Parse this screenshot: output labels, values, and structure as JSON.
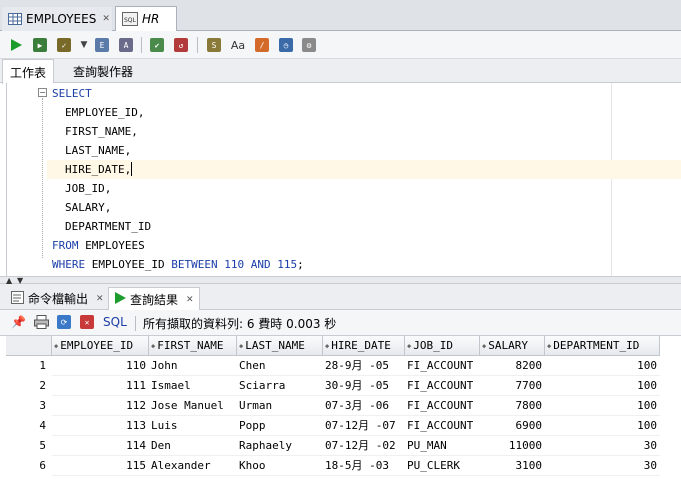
{
  "doc_tabs": [
    {
      "label": "EMPLOYEES",
      "icon": "table-icon"
    },
    {
      "label": "HR",
      "icon": "sql-worksheet-icon"
    }
  ],
  "sub_tabs": {
    "worksheet": "工作表",
    "query_builder": "查詢製作器"
  },
  "editor": {
    "lines": [
      {
        "kw": "SELECT",
        "text": ""
      },
      {
        "kw": "",
        "text": "EMPLOYEE_ID,"
      },
      {
        "kw": "",
        "text": "FIRST_NAME,"
      },
      {
        "kw": "",
        "text": "LAST_NAME,"
      },
      {
        "kw": "",
        "text": "HIRE_DATE,"
      },
      {
        "kw": "",
        "text": "JOB_ID,"
      },
      {
        "kw": "",
        "text": "SALARY,"
      },
      {
        "kw": "",
        "text": "DEPARTMENT_ID"
      },
      {
        "kw": "FROM",
        "text": " EMPLOYEES"
      }
    ],
    "where": {
      "kw1": "WHERE",
      "col": " EMPLOYEE_ID ",
      "kw2": "BETWEEN",
      "v1": "110",
      "kw3": "AND",
      "v2": "115",
      "end": ";"
    }
  },
  "bottom_tabs": {
    "script_output": "命令檔輸出",
    "query_result": "查詢結果"
  },
  "result_toolbar": {
    "sql_label": "SQL",
    "status": "所有擷取的資料列: 6 費時 0.003 秒"
  },
  "grid": {
    "columns": [
      "EMPLOYEE_ID",
      "FIRST_NAME",
      "LAST_NAME",
      "HIRE_DATE",
      "JOB_ID",
      "SALARY",
      "DEPARTMENT_ID"
    ],
    "rows": [
      {
        "n": "1",
        "id": "110",
        "first": "John",
        "last": "Chen",
        "hire": "28-9月 -05",
        "job": "FI_ACCOUNT",
        "salary": "8200",
        "dept": "100"
      },
      {
        "n": "2",
        "id": "111",
        "first": "Ismael",
        "last": "Sciarra",
        "hire": "30-9月 -05",
        "job": "FI_ACCOUNT",
        "salary": "7700",
        "dept": "100"
      },
      {
        "n": "3",
        "id": "112",
        "first": "Jose Manuel",
        "last": "Urman",
        "hire": "07-3月 -06",
        "job": "FI_ACCOUNT",
        "salary": "7800",
        "dept": "100"
      },
      {
        "n": "4",
        "id": "113",
        "first": "Luis",
        "last": "Popp",
        "hire": "07-12月 -07",
        "job": "FI_ACCOUNT",
        "salary": "6900",
        "dept": "100"
      },
      {
        "n": "5",
        "id": "114",
        "first": "Den",
        "last": "Raphaely",
        "hire": "07-12月 -02",
        "job": "PU_MAN",
        "salary": "11000",
        "dept": "30"
      },
      {
        "n": "6",
        "id": "115",
        "first": "Alexander",
        "last": "Khoo",
        "hire": "18-5月 -03",
        "job": "PU_CLERK",
        "salary": "3100",
        "dept": "30"
      }
    ]
  },
  "colors": {
    "keyword": "#1a3ea8",
    "run_green": "#1c9c2c",
    "current_line": "#fff8e6"
  }
}
